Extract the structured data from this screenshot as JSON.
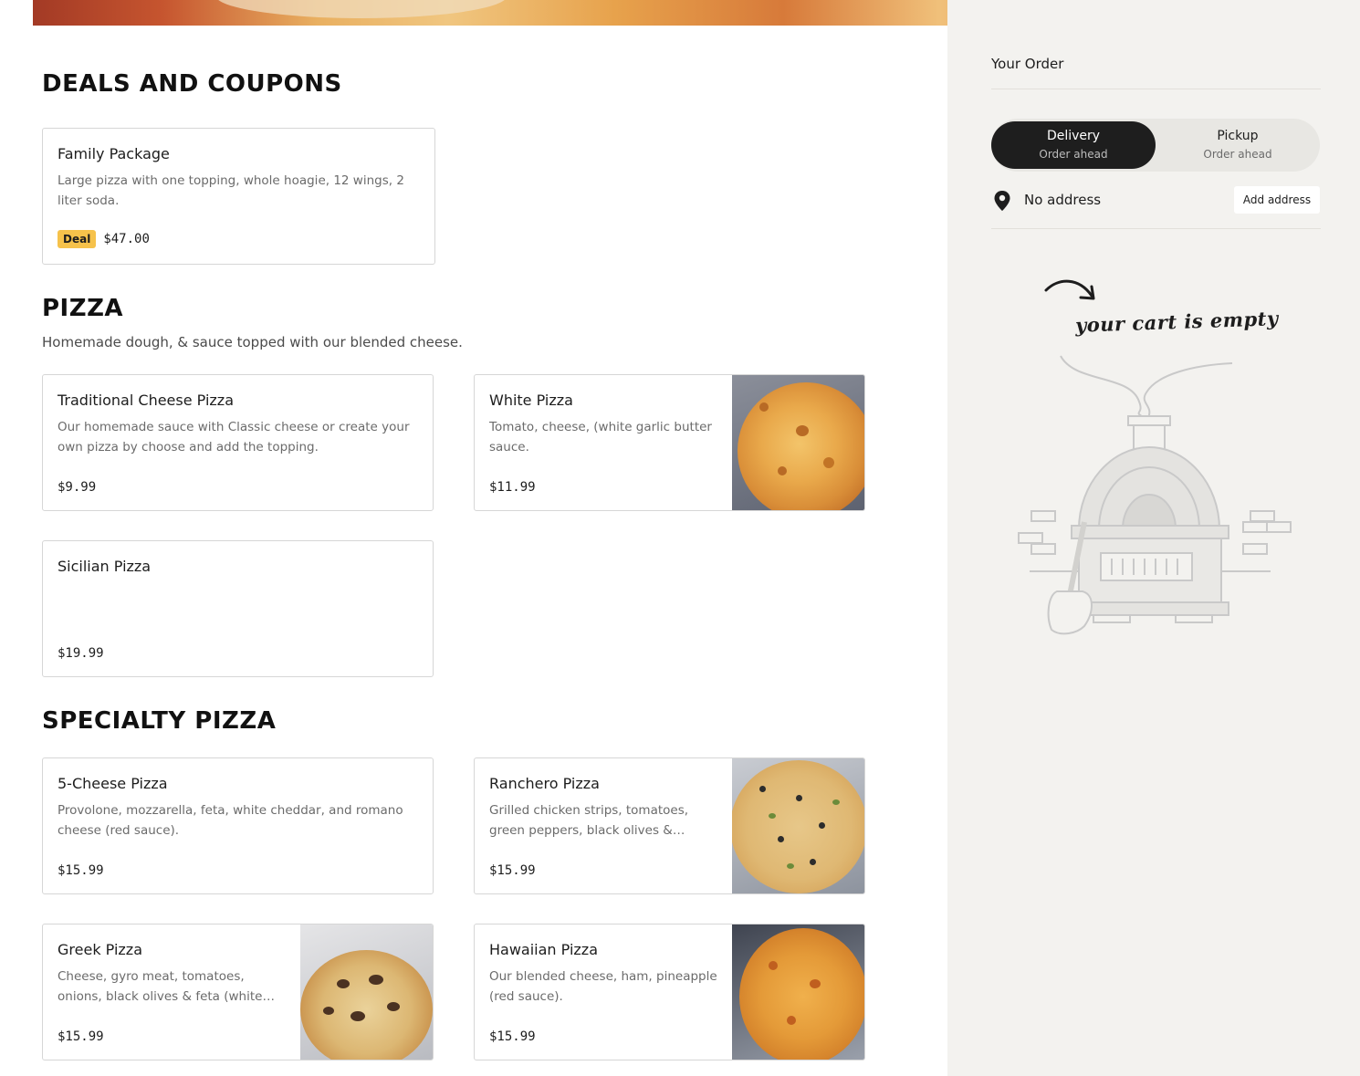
{
  "sections": {
    "deals": {
      "title": "DEALS AND COUPONS",
      "items": [
        {
          "name": "Family Package",
          "description": "Large pizza with one topping, whole hoagie, 12 wings, 2 liter soda.",
          "badge": "Deal",
          "price": "$47.00"
        }
      ]
    },
    "pizza": {
      "title": "PIZZA",
      "description": "Homemade dough, & sauce topped with our blended cheese.",
      "items": [
        {
          "name": "Traditional Cheese Pizza",
          "description": "Our homemade sauce with Classic cheese or create your own pizza by choose and add the topping.",
          "price": "$9.99"
        },
        {
          "name": "White Pizza",
          "description": "Tomato, cheese, (white garlic butter sauce.",
          "price": "$11.99",
          "image": "white-pizza-photo"
        },
        {
          "name": "Sicilian Pizza",
          "description": "",
          "price": "$19.99"
        }
      ]
    },
    "specialty": {
      "title": "SPECIALTY PIZZA",
      "items": [
        {
          "name": "5-Cheese Pizza",
          "description": "Provolone, mozzarella, feta, white cheddar, and romano cheese (red sauce).",
          "price": "$15.99"
        },
        {
          "name": "Ranchero Pizza",
          "description": "Grilled chicken strips, tomatoes, green peppers, black olives & cheese (ranch…",
          "price": "$15.99",
          "image": "ranchero-pizza-photo"
        },
        {
          "name": "Greek Pizza",
          "description": "Cheese, gyro meat, tomatoes, onions, black olives & feta (white sauce).",
          "price": "$15.99",
          "image": "greek-pizza-photo"
        },
        {
          "name": "Hawaiian Pizza",
          "description": "Our blended cheese, ham, pineapple (red sauce).",
          "price": "$15.99",
          "image": "hawaiian-pizza-photo"
        }
      ]
    }
  },
  "order": {
    "title": "Your Order",
    "modes": [
      {
        "label": "Delivery",
        "sub": "Order ahead",
        "active": true
      },
      {
        "label": "Pickup",
        "sub": "Order ahead",
        "active": false
      }
    ],
    "address": {
      "text": "No address",
      "button": "Add address",
      "icon": "location-pin-icon"
    },
    "empty_cart": {
      "text": "your cart is empty",
      "illustration": "pizza-oven-illustration"
    }
  },
  "colors": {
    "deal_badge": "#f6c24b",
    "toggle_active_bg": "#1e1e1e",
    "sidebar_bg": "#f3f2ef"
  }
}
